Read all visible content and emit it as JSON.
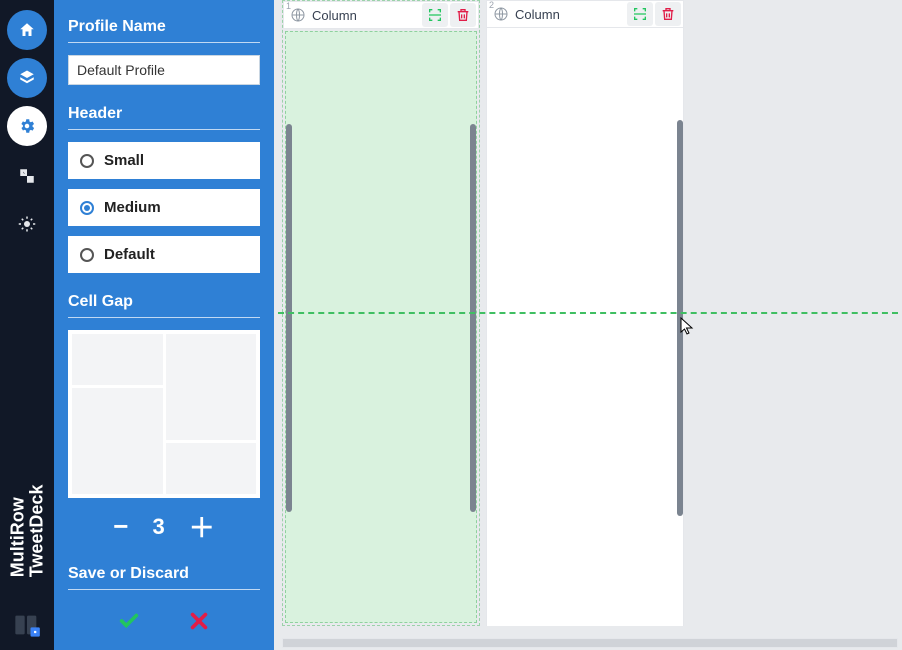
{
  "brand": {
    "line1": "MultiRow",
    "line2": "TweetDeck"
  },
  "rail": {
    "home": "home-icon",
    "layers": "layers-icon",
    "settings": "gear-icon",
    "translate": "translate-icon",
    "theme": "brightness-icon"
  },
  "panel": {
    "profileName": {
      "title": "Profile Name",
      "value": "Default Profile"
    },
    "header": {
      "title": "Header",
      "options": [
        {
          "label": "Small",
          "selected": false
        },
        {
          "label": "Medium",
          "selected": true
        },
        {
          "label": "Default",
          "selected": false
        }
      ]
    },
    "cellGap": {
      "title": "Cell Gap",
      "value": "3"
    },
    "saveDiscard": {
      "title": "Save or Discard"
    }
  },
  "canvas": {
    "columns": [
      {
        "number": "1",
        "label": "Column",
        "active": true
      },
      {
        "number": "2",
        "label": "Column",
        "active": false
      }
    ]
  },
  "colors": {
    "accent": "#2f80d5",
    "green": "#3fbf62",
    "danger": "#e11d48"
  }
}
